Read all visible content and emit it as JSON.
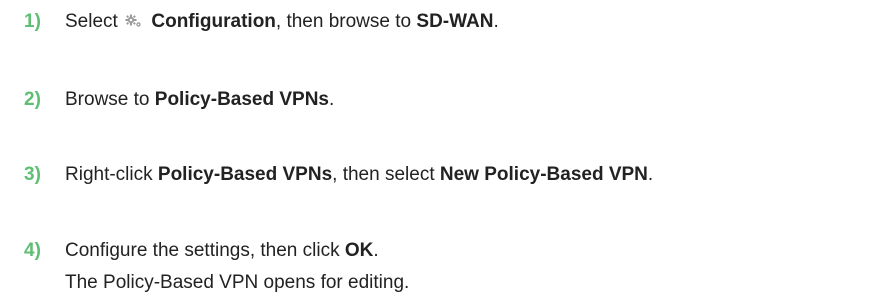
{
  "colors": {
    "step_number": "#5ebf73",
    "text": "#222222"
  },
  "steps": [
    {
      "number": "1)",
      "t1": "Select",
      "icon": "gear-icon",
      "b1": "Configuration",
      "t2": ", then browse to",
      "b2": "SD-WAN",
      "t3": "."
    },
    {
      "number": "2)",
      "t1": "Browse to",
      "b1": "Policy-Based VPNs",
      "t2": "."
    },
    {
      "number": "3)",
      "t1": "Right-click",
      "b1": "Policy-Based VPNs",
      "t2": ", then select",
      "b2": "New Policy-Based VPN",
      "t3": "."
    },
    {
      "number": "4)",
      "t1": "Configure the settings, then click",
      "b1": "OK",
      "t2": ".",
      "result": "The Policy-Based VPN opens for editing."
    }
  ]
}
